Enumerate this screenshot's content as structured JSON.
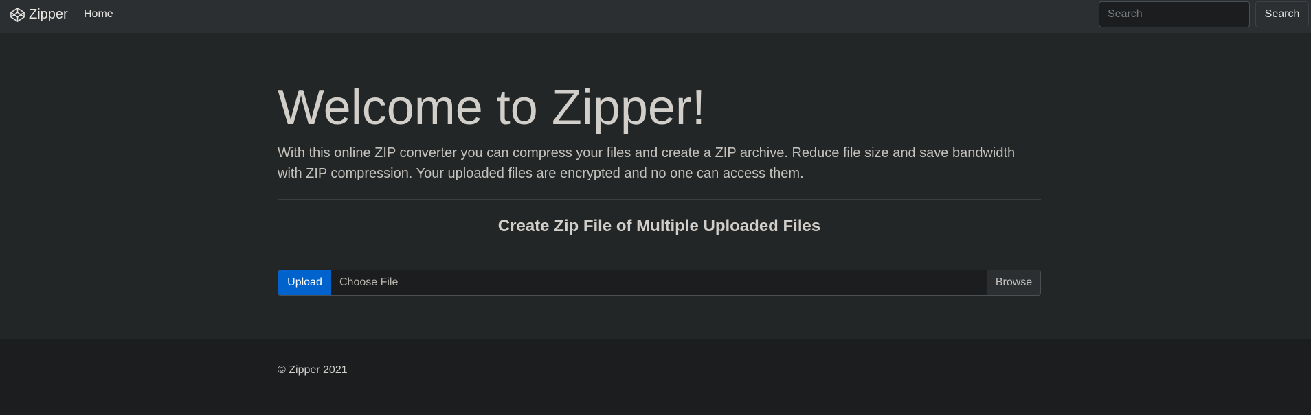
{
  "navbar": {
    "brand": "Zipper",
    "brand_icon": "codepen-logo-icon",
    "home_link": "Home",
    "search_placeholder": "Search",
    "search_button": "Search"
  },
  "hero": {
    "title": "Welcome to Zipper!",
    "lead": "With this online ZIP converter you can compress your files and create a ZIP archive. Reduce file size and save bandwidth with ZIP compression. Your uploaded files are encrypted and no one can access them."
  },
  "upload": {
    "section_title": "Create Zip File of Multiple Uploaded Files",
    "upload_button": "Upload",
    "file_label": "Choose File",
    "browse_button": "Browse"
  },
  "footer": {
    "copyright": "© Zipper 2021"
  },
  "colors": {
    "navbar_bg": "#2b2f32",
    "jumbotron_bg": "#232627",
    "footer_bg": "#1b1d1e",
    "primary": "#0062cc"
  }
}
